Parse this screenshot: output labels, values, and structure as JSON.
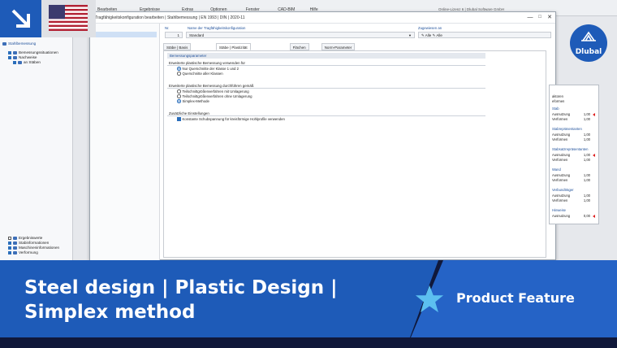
{
  "colors": {
    "banner_blue": "#1e5bb8",
    "banner_dark": "#10183a",
    "accent": "#2a6ebb",
    "flag_red": "#b22234",
    "flag_blue": "#3c3b6e"
  },
  "background_app": {
    "menus": [
      "Bearbeiten",
      "Ergebnisse",
      "Extras",
      "Optionen",
      "Fenster",
      "CAD-BIM",
      "Hilfe"
    ],
    "title_text": "Online-Lizenz 6 | Dlubal Software GmbH",
    "panel_title": "Stahlbemessung",
    "tree_top": [
      {
        "label": "Bemessungssituationen",
        "checked": true
      },
      {
        "label": "Nachweise",
        "checked": true
      },
      {
        "label": "an Stäben",
        "checked": true
      }
    ],
    "tree_bottom": [
      {
        "label": "Ergebniswerte",
        "checked": false
      },
      {
        "label": "Stabinformationen",
        "checked": true
      },
      {
        "label": "Maschineninformationen",
        "checked": true
      },
      {
        "label": "Verformung",
        "checked": true
      }
    ]
  },
  "dialog": {
    "title": "Tragfähigkeitskonfiguration bearbeiten | Stahlbemessung | EN 1993 | DIN | 2020-11",
    "no_label": "Nr.",
    "no_value": "1",
    "name_label": "Name der Tragfähigkeitskonfiguration",
    "name_value": "Standard",
    "assigned_label": "Zugewiesen an",
    "assigned_items": [
      "Alle",
      "Alle"
    ],
    "tabs": [
      "Stäbe | Basis",
      "Stäbe | Plastizität",
      "Flächen",
      "Norm-Parameter"
    ],
    "active_tab": 1,
    "section_header": "Bemessungsparameter",
    "groups": [
      {
        "title": "Erweiterte plastische Bemessung verwenden für",
        "options": [
          {
            "label": "Nur Querschnitte der Klasse 1 und 2",
            "type": "radio",
            "on": true
          },
          {
            "label": "Querschnitte aller Klassen",
            "type": "radio",
            "on": false
          }
        ]
      },
      {
        "title": "Erweiterte plastische Bemessung durchführen gemäß",
        "options": [
          {
            "label": "Teilschnittgrößenverfahren mit Umlagerung",
            "type": "radio",
            "on": false
          },
          {
            "label": "Teilschnittgrößenverfahren ohne Umlagerung",
            "type": "radio",
            "on": false
          },
          {
            "label": "Simplex-Methode",
            "type": "radio",
            "on": true
          }
        ]
      },
      {
        "title": "Zusätzliche Einstellungen",
        "options": [
          {
            "label": "Konstante Schubspannung für kreisförmige Hohlprofile verwenden",
            "type": "check",
            "on": true
          }
        ]
      }
    ]
  },
  "side_panel": {
    "top": [
      "aktoren",
      "eformen"
    ],
    "rows": [
      {
        "section": "Stab",
        "items": [
          {
            "label": "Ausnutzung",
            "value": "1,00",
            "flag": true
          },
          {
            "label": "Verformen",
            "value": "1,00",
            "flag": false
          }
        ]
      },
      {
        "section": "Stabrepräsentanten",
        "items": [
          {
            "label": "Ausnutzung",
            "value": "1,00",
            "flag": false
          },
          {
            "label": "Verformen",
            "value": "1,00",
            "flag": false
          }
        ]
      },
      {
        "section": "Stabsatzrepräsentanten",
        "items": [
          {
            "label": "Ausnutzung",
            "value": "1,00",
            "flag": true
          },
          {
            "label": "Verformen",
            "value": "1,00",
            "flag": false
          }
        ]
      },
      {
        "section": "Wand",
        "items": [
          {
            "label": "Ausnutzung",
            "value": "1,00",
            "flag": false
          },
          {
            "label": "Verformen",
            "value": "1,00",
            "flag": false
          }
        ]
      },
      {
        "section": "Verbundträger",
        "items": [
          {
            "label": "Ausnutzung",
            "value": "1,00",
            "flag": false
          },
          {
            "label": "Verformen",
            "value": "1,00",
            "flag": false
          }
        ]
      },
      {
        "section": "Hinweise",
        "items": [
          {
            "label": "Ausnutzung",
            "value": "0,00",
            "flag": true
          }
        ]
      }
    ]
  },
  "logo": {
    "text": "Dlubal"
  },
  "banner": {
    "title": "Steel design | Plastic Design | Simplex method",
    "feature": "Product Feature"
  }
}
